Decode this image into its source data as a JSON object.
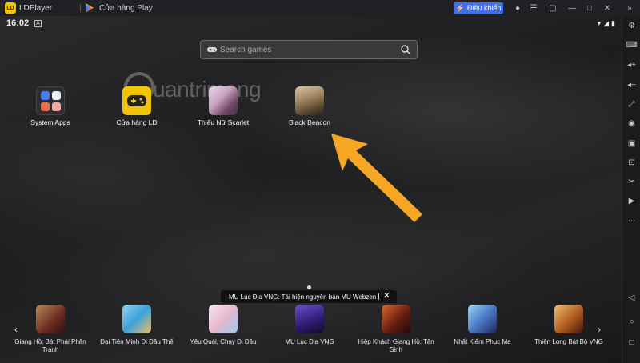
{
  "window": {
    "app_title": "LDPlayer",
    "tab_label": "Cửa hàng Play",
    "control_button": "Điều khiển"
  },
  "status_bar": {
    "time": "16:02",
    "notification_icon": "A"
  },
  "search": {
    "placeholder": "Search games"
  },
  "watermark": {
    "text": "uantrimang"
  },
  "desktop_apps": [
    {
      "label": "System Apps"
    },
    {
      "label": "Cửa hàng LD"
    },
    {
      "label": "Thiếu Nữ Scarlet"
    },
    {
      "label": "Black Beacon"
    }
  ],
  "banner": {
    "text": "MU Lục Địa VNG: Tái hiện nguyên bản MU Webzen"
  },
  "dock_apps": [
    {
      "label": "Giang Hồ: Bát Phái Phân Tranh"
    },
    {
      "label": "Đại Tiên Minh Đi Đâu Thế"
    },
    {
      "label": "Yêu Quái, Chạy Đi Đâu"
    },
    {
      "label": "MU Lục Địa VNG"
    },
    {
      "label": "Hiệp Khách Giang Hồ: Tân Sinh"
    },
    {
      "label": "Nhất Kiếm Phục Ma"
    },
    {
      "label": "Thiên Long Bát Bộ VNG"
    }
  ],
  "colors": {
    "accent": "#3f6ff2",
    "arrow": "#f5a623"
  }
}
